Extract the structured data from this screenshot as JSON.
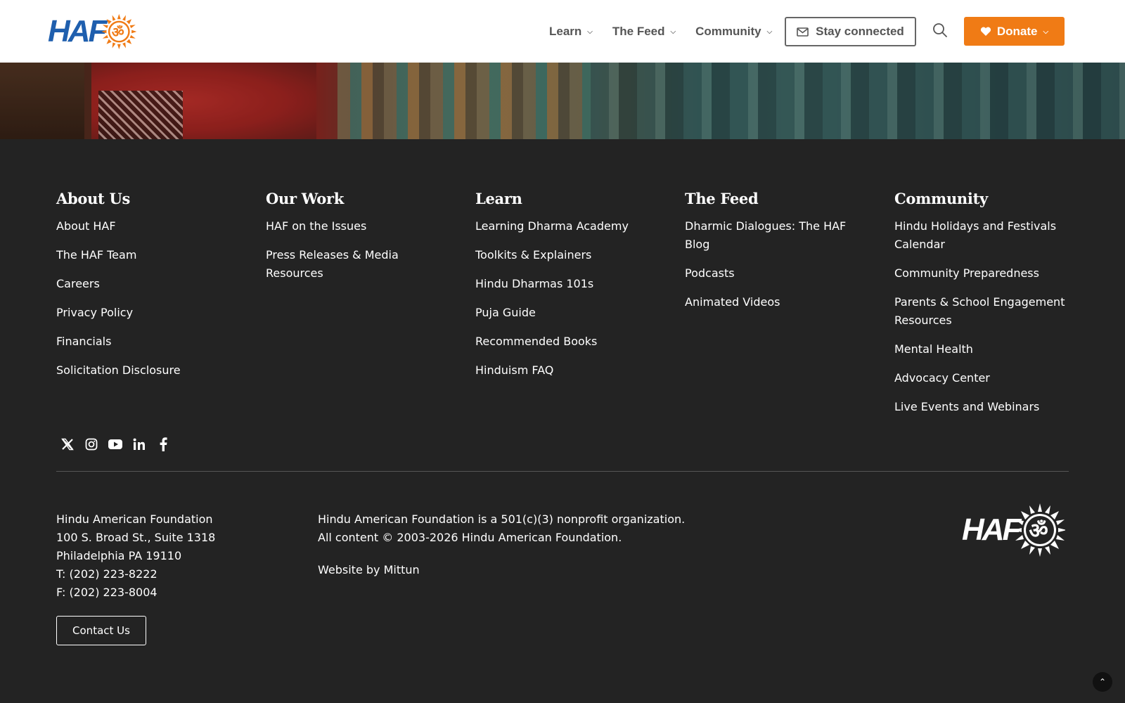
{
  "header": {
    "logo_text": "HAF",
    "nav": [
      {
        "label": "Learn"
      },
      {
        "label": "The Feed"
      },
      {
        "label": "Community"
      }
    ],
    "stay_connected": "Stay connected",
    "donate": "Donate",
    "accent": "#f07b15",
    "brand_blue": "#1f5fae"
  },
  "footer": {
    "columns": [
      {
        "title": "About Us",
        "links": [
          "About HAF",
          "The HAF Team",
          "Careers",
          "Privacy Policy",
          "Financials",
          "Solicitation Disclosure"
        ]
      },
      {
        "title": "Our Work",
        "links": [
          "HAF on the Issues",
          "Press Releases & Media Resources"
        ]
      },
      {
        "title": "Learn",
        "links": [
          "Learning Dharma Academy",
          "Toolkits & Explainers",
          "Hindu Dharmas 101s",
          "Puja Guide",
          "Recommended Books",
          "Hinduism FAQ"
        ]
      },
      {
        "title": "The Feed",
        "links": [
          "Dharmic Dialogues: The HAF Blog",
          "Podcasts",
          "Animated Videos"
        ]
      },
      {
        "title": "Community",
        "links": [
          "Hindu Holidays and Festivals Calendar",
          "Community Preparedness",
          "Parents & School Engagement Resources",
          "Mental Health",
          "Advocacy Center",
          "Live Events and Webinars"
        ]
      }
    ],
    "social": [
      "x-icon",
      "instagram-icon",
      "youtube-icon",
      "linkedin-icon",
      "facebook-icon"
    ],
    "address": {
      "org": "Hindu American Foundation",
      "street": "100 S. Broad St., Suite 1318",
      "city": "Philadelphia PA 19110",
      "phone": "T: (202) 223-8222",
      "fax": "F: (202) 223-8004"
    },
    "contact_button": "Contact Us",
    "legal_line1": "Hindu American Foundation is a 501(c)(3) nonprofit organization.",
    "legal_line2": "All content © 2003-2026 Hindu American Foundation.",
    "website_by_prefix": "Website by",
    "website_by_link": "Mittun",
    "logo_text": "HAF"
  }
}
